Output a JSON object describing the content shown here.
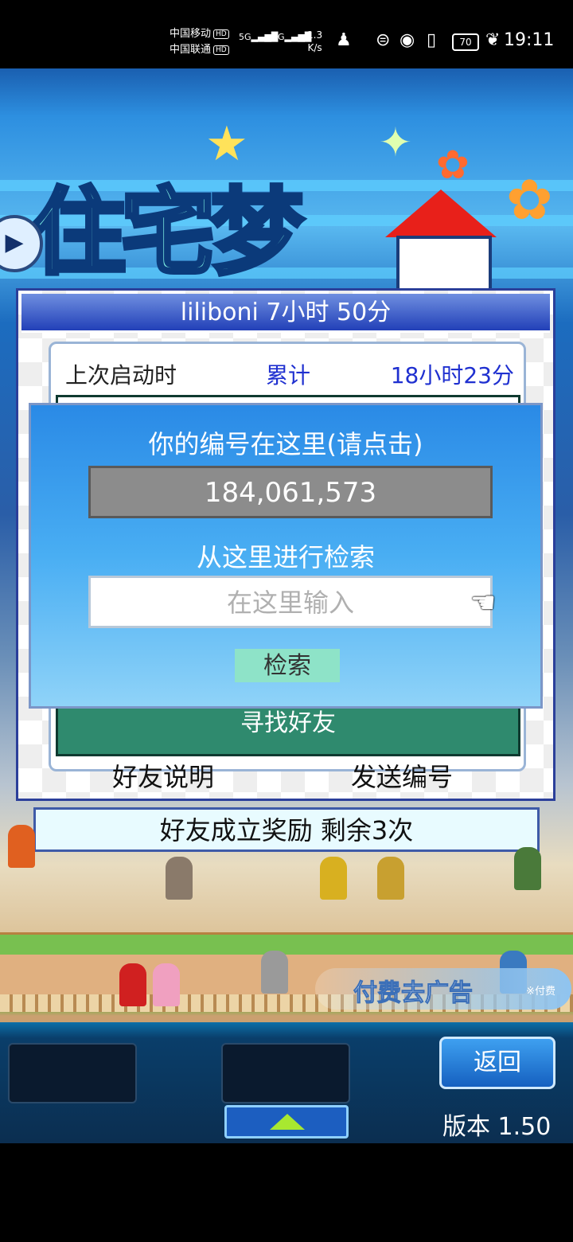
{
  "status_bar": {
    "carrier1": "中国移动",
    "carrier2": "中国联通",
    "hd": "HD",
    "net1": "5G",
    "net2": "4G",
    "speed_value": "1.3",
    "speed_unit": "K/s",
    "battery": "70",
    "time": "19:11"
  },
  "panel": {
    "title": "liliboni  7小时 50分",
    "last_launch_label": "上次启动时",
    "total_label": "累计",
    "total_value": "18小时23分",
    "find_friend": "寻找好友",
    "friend_help": "好友说明",
    "send_id": "发送编号"
  },
  "dialog": {
    "title": "你的编号在这里(请点击)",
    "id_value": "184,061,573",
    "search_label": "从这里进行检索",
    "search_placeholder": "在这里输入",
    "search_button": "检索"
  },
  "reward_bar": "好友成立奖励  剩余3次",
  "ad": {
    "label": "付费去广告",
    "note": "※付费"
  },
  "bottom_nav": {
    "back_button": "返回",
    "version": "版本 1.50"
  }
}
